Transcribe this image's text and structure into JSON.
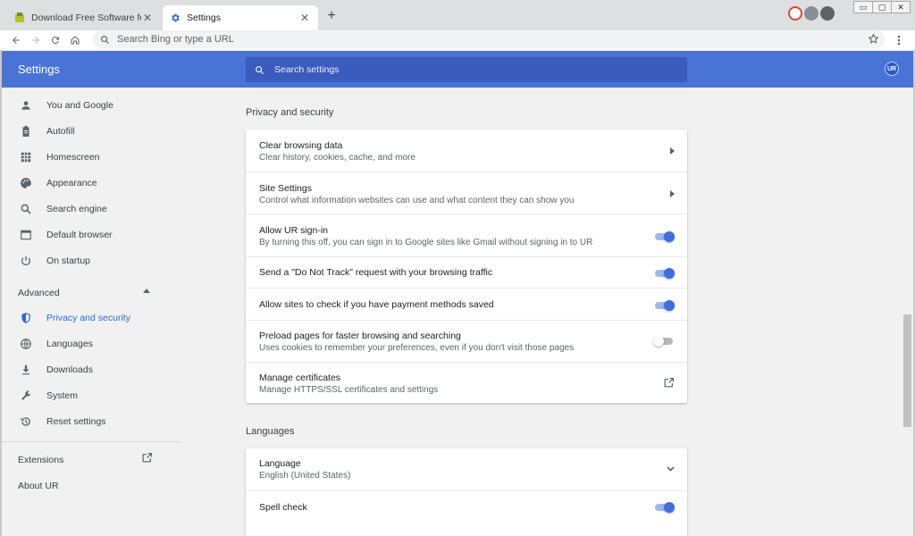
{
  "tabs": [
    {
      "title": "Download Free Software for Windows",
      "close": "✕"
    },
    {
      "title": "Settings",
      "close": "✕"
    }
  ],
  "new_tab": "+",
  "window_controls": [
    "▭",
    "▢",
    "✕"
  ],
  "omnibox": {
    "placeholder": "Search Bing or type a URL"
  },
  "header": {
    "title": "Settings",
    "search_placeholder": "Search settings",
    "avatar": "UR"
  },
  "sidebar": {
    "items": [
      {
        "label": "You and Google",
        "icon": "person-icon"
      },
      {
        "label": "Autofill",
        "icon": "clipboard-icon"
      },
      {
        "label": "Homescreen",
        "icon": "grid-icon"
      },
      {
        "label": "Appearance",
        "icon": "palette-icon"
      },
      {
        "label": "Search engine",
        "icon": "search-icon"
      },
      {
        "label": "Default browser",
        "icon": "browser-window-icon"
      },
      {
        "label": "On startup",
        "icon": "power-icon"
      }
    ],
    "advanced_label": "Advanced",
    "advanced_items": [
      {
        "label": "Privacy and security",
        "icon": "shield-icon",
        "selected": true
      },
      {
        "label": "Languages",
        "icon": "globe-icon"
      },
      {
        "label": "Downloads",
        "icon": "download-icon"
      },
      {
        "label": "System",
        "icon": "wrench-icon"
      },
      {
        "label": "Reset settings",
        "icon": "history-icon"
      }
    ],
    "extensions_label": "Extensions",
    "about_label": "About UR"
  },
  "privacy": {
    "title": "Privacy and security",
    "rows": [
      {
        "title": "Clear browsing data",
        "subtitle": "Clear history, cookies, cache, and more",
        "control": "arrow"
      },
      {
        "title": "Site Settings",
        "subtitle": "Control what information websites can use and what content they can show you",
        "control": "arrow"
      },
      {
        "title": "Allow UR sign-in",
        "subtitle": "By turning this off, you can sign in to Google sites like Gmail without signing in to UR",
        "control": "toggle",
        "on": true
      },
      {
        "title": "Send a \"Do Not Track\" request with your browsing traffic",
        "subtitle": "",
        "control": "toggle",
        "on": true
      },
      {
        "title": "Allow sites to check if you have payment methods saved",
        "subtitle": "",
        "control": "toggle",
        "on": true
      },
      {
        "title": "Preload pages for faster browsing and searching",
        "subtitle": "Uses cookies to remember your preferences, even if you don't visit those pages",
        "control": "toggle",
        "on": false
      },
      {
        "title": "Manage certificates",
        "subtitle": "Manage HTTPS/SSL certificates and settings",
        "control": "external"
      }
    ]
  },
  "languages": {
    "title": "Languages",
    "rows": [
      {
        "title": "Language",
        "subtitle": "English (United States)",
        "control": "expand"
      },
      {
        "title": "Spell check",
        "subtitle": "",
        "control": "toggle",
        "on": true
      }
    ]
  },
  "colors": {
    "header": "#4a73d6",
    "search": "#3b5bbd",
    "accent": "#3367d6",
    "toggle_on": "#3e6fdc"
  }
}
